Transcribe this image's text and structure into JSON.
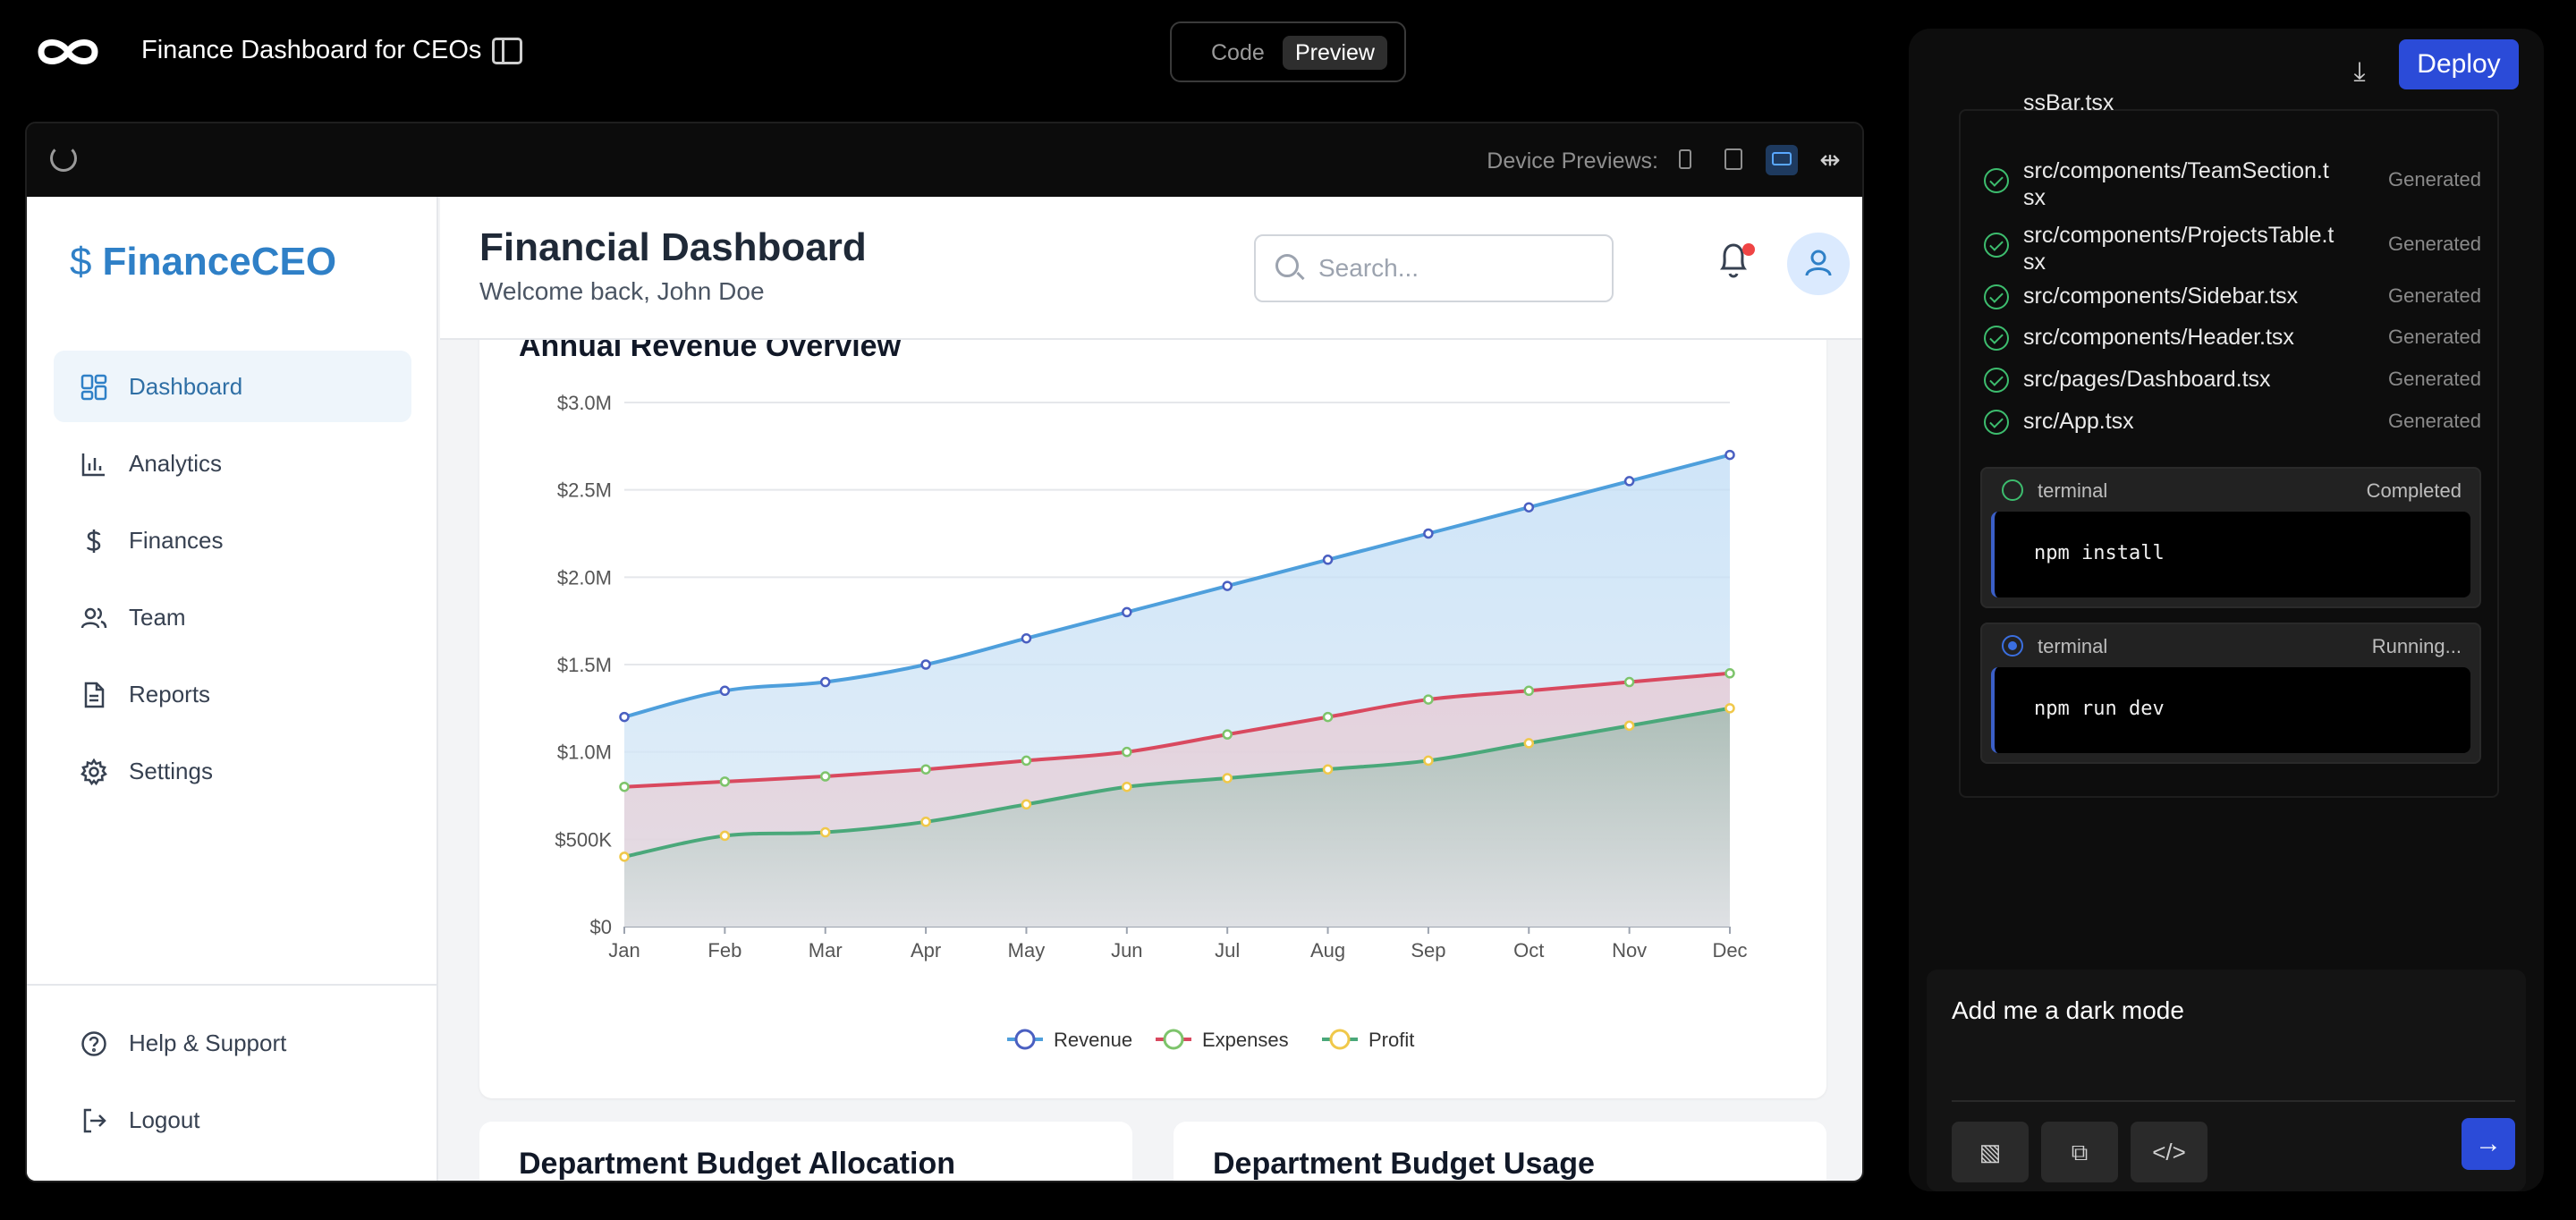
{
  "app": {
    "title": "Finance Dashboard for CEOs",
    "mode_code": "Code",
    "mode_preview": "Preview"
  },
  "toolbar": {
    "device_label": "Device Previews:"
  },
  "brand": {
    "name": "FinanceCEO"
  },
  "nav": [
    {
      "label": "Dashboard",
      "icon": "grid-icon",
      "active": true
    },
    {
      "label": "Analytics",
      "icon": "bar-chart-icon"
    },
    {
      "label": "Finances",
      "icon": "dollar-icon"
    },
    {
      "label": "Team",
      "icon": "users-icon"
    },
    {
      "label": "Reports",
      "icon": "file-icon"
    },
    {
      "label": "Settings",
      "icon": "gear-icon"
    }
  ],
  "bottom_nav": [
    {
      "label": "Help & Support",
      "icon": "help-icon"
    },
    {
      "label": "Logout",
      "icon": "logout-icon"
    }
  ],
  "header": {
    "title": "Financial Dashboard",
    "subtitle": "Welcome back, John Doe",
    "search_placeholder": "Search..."
  },
  "chart_card": {
    "title": "Annual Revenue Overview"
  },
  "budget_cards": [
    "Department Budget Allocation",
    "Department Budget Usage"
  ],
  "chart_data": {
    "type": "area",
    "categories": [
      "Jan",
      "Feb",
      "Mar",
      "Apr",
      "May",
      "Jun",
      "Jul",
      "Aug",
      "Sep",
      "Oct",
      "Nov",
      "Dec"
    ],
    "series": [
      {
        "name": "Revenue",
        "color": "#4e9fdc",
        "values": [
          1.2,
          1.35,
          1.4,
          1.5,
          1.65,
          1.8,
          1.95,
          2.1,
          2.25,
          2.4,
          2.55,
          2.7
        ]
      },
      {
        "name": "Expenses",
        "color": "#d9495f",
        "values": [
          0.8,
          0.83,
          0.86,
          0.9,
          0.95,
          1.0,
          1.1,
          1.2,
          1.3,
          1.35,
          1.4,
          1.45
        ]
      },
      {
        "name": "Profit",
        "color": "#4aa87a",
        "values": [
          0.4,
          0.52,
          0.54,
          0.6,
          0.7,
          0.8,
          0.85,
          0.9,
          0.95,
          1.05,
          1.15,
          1.25
        ]
      }
    ],
    "y_ticks": [
      "$0",
      "$500K",
      "$1.0M",
      "$1.5M",
      "$2.0M",
      "$2.5M",
      "$3.0M"
    ],
    "ylim": [
      0,
      3
    ],
    "y_unit": "$M",
    "legend": "bottom",
    "grid": true
  },
  "files": [
    {
      "name": "ssBar.tsx",
      "status": ""
    },
    {
      "name": "src/components/TeamSection.t sx",
      "status": "Generated"
    },
    {
      "name": "src/components/ProjectsTable.t sx",
      "status": "Generated"
    },
    {
      "name": "src/components/Sidebar.tsx",
      "status": "Generated"
    },
    {
      "name": "src/components/Header.tsx",
      "status": "Generated"
    },
    {
      "name": "src/pages/Dashboard.tsx",
      "status": "Generated"
    },
    {
      "name": "src/App.tsx",
      "status": "Generated"
    }
  ],
  "terminals": [
    {
      "name": "terminal",
      "status": "Completed",
      "command": "npm install"
    },
    {
      "name": "terminal",
      "status": "Running...",
      "command": "npm run dev"
    }
  ],
  "deploy_label": "Deploy",
  "prompt": {
    "text": "Add me a dark mode"
  }
}
